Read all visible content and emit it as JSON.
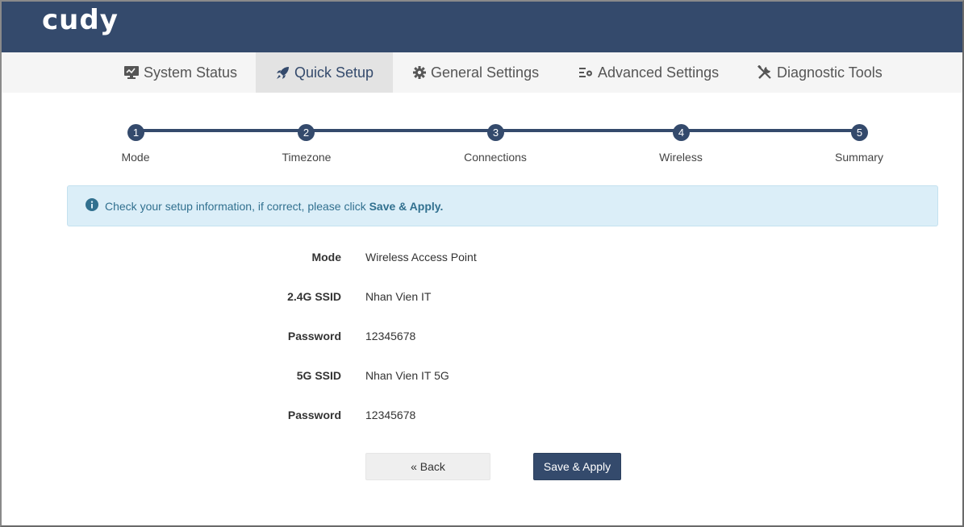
{
  "header": {
    "logo": "cudy"
  },
  "nav": {
    "items": [
      {
        "label": "System Status",
        "icon": "monitor-icon"
      },
      {
        "label": "Quick Setup",
        "icon": "rocket-icon",
        "active": true
      },
      {
        "label": "General Settings",
        "icon": "gear-icon"
      },
      {
        "label": "Advanced Settings",
        "icon": "advanced-settings-icon"
      },
      {
        "label": "Diagnostic Tools",
        "icon": "tools-icon"
      }
    ]
  },
  "steps": [
    {
      "num": "1",
      "label": "Mode"
    },
    {
      "num": "2",
      "label": "Timezone"
    },
    {
      "num": "3",
      "label": "Connections"
    },
    {
      "num": "4",
      "label": "Wireless"
    },
    {
      "num": "5",
      "label": "Summary"
    }
  ],
  "alert": {
    "text": "Check your setup information, if correct, please click",
    "emphasis": "Save & Apply.",
    "icon": "info-icon"
  },
  "summary": [
    {
      "label": "Mode",
      "value": "Wireless Access Point"
    },
    {
      "label": "2.4G SSID",
      "value": "Nhan Vien IT"
    },
    {
      "label": "Password",
      "value": "12345678"
    },
    {
      "label": "5G SSID",
      "value": "Nhan Vien IT 5G"
    },
    {
      "label": "Password",
      "value": "12345678"
    }
  ],
  "buttons": {
    "back": "« Back",
    "save": "Save & Apply"
  },
  "colors": {
    "brand": "#344a6c",
    "alert_bg": "#dbeef8",
    "alert_text": "#31708f"
  }
}
